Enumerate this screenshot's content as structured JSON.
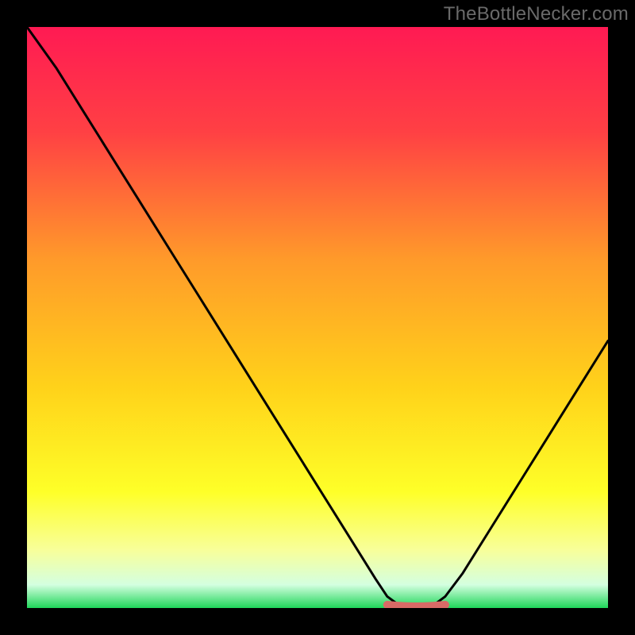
{
  "attribution": "TheBottleNecker.com",
  "colors": {
    "bg": "#000000",
    "gradient_top": "#ff1a53",
    "gradient_mid": "#ffd21a",
    "gradient_yellow": "#feff28",
    "gradient_paleyellow": "#faffa0",
    "gradient_green": "#1fd65a",
    "curve": "#000000",
    "marker": "#d86a66"
  },
  "chart_data": {
    "type": "line",
    "title": "",
    "xlabel": "",
    "ylabel": "",
    "xlim": [
      0,
      100
    ],
    "ylim": [
      0,
      100
    ],
    "x": [
      0,
      5,
      10,
      15,
      20,
      25,
      30,
      35,
      40,
      45,
      50,
      55,
      60,
      62,
      64,
      66,
      68,
      70,
      72,
      75,
      80,
      85,
      90,
      95,
      100
    ],
    "values": [
      100,
      93,
      85,
      77,
      69,
      61,
      53,
      45,
      37,
      29,
      21,
      13,
      5,
      2,
      0.5,
      0,
      0,
      0.5,
      2,
      6,
      14,
      22,
      30,
      38,
      46
    ],
    "flat_segment": {
      "x_start": 62,
      "x_end": 72,
      "y": 0
    },
    "annotations": []
  }
}
